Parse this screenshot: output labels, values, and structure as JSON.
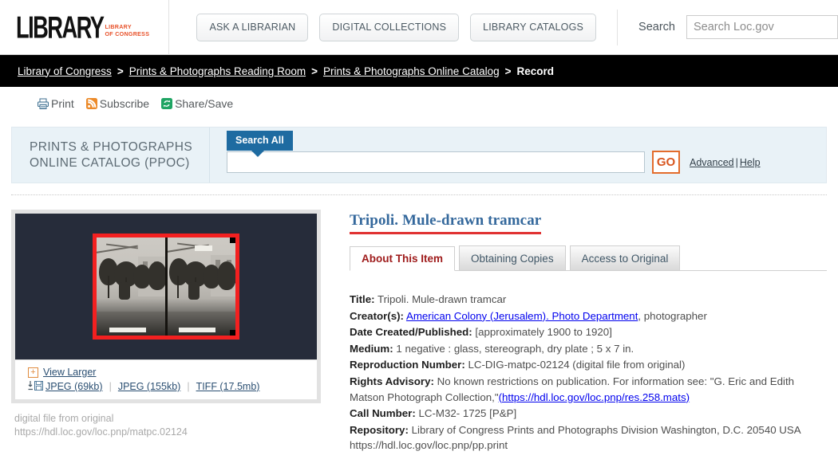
{
  "header": {
    "logo_word": "LIBRARY",
    "logo_sub_line1": "LIBRARY",
    "logo_sub_line2": "OF CONGRESS",
    "nav": [
      {
        "label": "ASK A LIBRARIAN"
      },
      {
        "label": "DIGITAL COLLECTIONS"
      },
      {
        "label": "LIBRARY CATALOGS"
      }
    ],
    "search_label": "Search",
    "search_placeholder": "Search Loc.gov",
    "search_value": ""
  },
  "breadcrumb": {
    "items": [
      {
        "label": "Library of Congress",
        "link": true
      },
      {
        "label": "Prints & Photographs Reading Room",
        "link": true
      },
      {
        "label": "Prints & Photographs Online Catalog",
        "link": true
      },
      {
        "label": "Record",
        "link": false
      }
    ],
    "separator": ">"
  },
  "toolbar": {
    "print_label": "Print",
    "subscribe_label": "Subscribe",
    "share_label": "Share/Save"
  },
  "ppoc": {
    "title_line1": "PRINTS & PHOTOGRAPHS",
    "title_line2": "ONLINE CATALOG (PPOC)",
    "search_all_tab": "Search All",
    "search_value": "",
    "search_placeholder": "",
    "go_label": "GO",
    "advanced_label": "Advanced",
    "pipe": "|",
    "help_label": "Help"
  },
  "image_panel": {
    "view_larger_label": "View Larger",
    "plus_glyph": "+",
    "downloads": [
      {
        "label": "JPEG (69kb)"
      },
      {
        "label": "JPEG (155kb)"
      },
      {
        "label": "TIFF (17.5mb)"
      }
    ],
    "caption_line1": "digital file from original",
    "caption_line2": "https://hdl.loc.gov/loc.pnp/matpc.02124"
  },
  "record": {
    "title": "Tripoli. Mule-drawn tramcar",
    "tabs": [
      {
        "label": "About This Item",
        "active": true
      },
      {
        "label": "Obtaining Copies",
        "active": false
      },
      {
        "label": "Access to Original",
        "active": false
      }
    ],
    "fields": {
      "title_label": "Title:",
      "title_value": "Tripoli. Mule-drawn tramcar",
      "creator_label": "Creator(s):",
      "creator_link": "American Colony (Jerusalem). Photo Department",
      "creator_suffix": ", photographer",
      "date_label": "Date Created/Published:",
      "date_value": "[approximately 1900 to 1920]",
      "medium_label": "Medium:",
      "medium_value": "1 negative : glass, stereograph, dry plate ; 5 x 7 in.",
      "repro_label": "Reproduction Number:",
      "repro_value": "LC-DIG-matpc-02124 (digital file from original)",
      "rights_label": "Rights Advisory:",
      "rights_value": "No known restrictions on publication. For information see: \"G. Eric and Edith Matson Photograph Collection,\"",
      "rights_link": "(https://hdl.loc.gov/loc.pnp/res.258.mats)",
      "call_label": "Call Number:",
      "call_value": "LC-M32- 1725 [P&P]",
      "repository_label": "Repository:",
      "repository_value": "Library of Congress Prints and Photographs Division Washington, D.C. 20540 USA https://hdl.loc.gov/loc.pnp/pp.print"
    }
  },
  "colors": {
    "brand_orange": "#e8522b",
    "breadcrumb_bg": "#000000",
    "ppoc_panel_bg": "#e9f2f7",
    "search_tab_blue": "#1e6ba1",
    "go_orange": "#e36c2c",
    "title_blue": "#34689c",
    "title_underline_red": "#e03232",
    "active_tab_red": "#9e1a1a",
    "image_border_red": "#f32020",
    "image_stage_bg": "#262c3a"
  }
}
